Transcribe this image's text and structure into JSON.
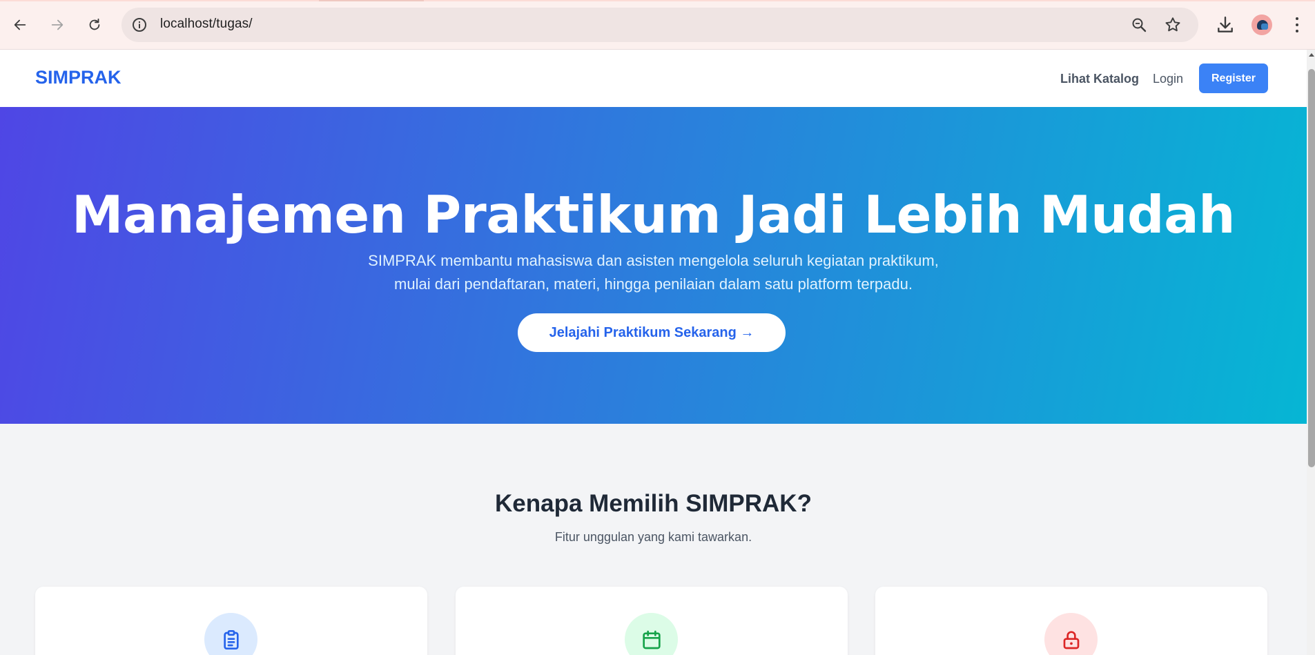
{
  "browser": {
    "url": "localhost/tugas/"
  },
  "nav": {
    "brand": "SIMPRAK",
    "catalog_link": "Lihat Katalog",
    "login_link": "Login",
    "register_button": "Register"
  },
  "hero": {
    "title": "Manajemen Praktikum Jadi Lebih Mudah",
    "subtitle_line1": "SIMPRAK membantu mahasiswa dan asisten mengelola seluruh kegiatan praktikum,",
    "subtitle_line2": "mulai dari pendaftaran, materi, hingga penilaian dalam satu platform terpadu.",
    "cta": "Jelajahi Praktikum Sekarang →"
  },
  "features": {
    "title": "Kenapa Memilih SIMPRAK?",
    "subtitle": "Fitur unggulan yang kami tawarkan.",
    "cards": [
      {
        "icon": "clipboard-icon",
        "color": "#2563eb",
        "bg": "#dbeafe"
      },
      {
        "icon": "calendar-icon",
        "color": "#16a34a",
        "bg": "#dcfce7"
      },
      {
        "icon": "lock-icon",
        "color": "#dc2626",
        "bg": "#fee2e2"
      }
    ]
  },
  "colors": {
    "brand": "#2563eb",
    "register_bg": "#3b82f6",
    "hero_gradient_start": "#4f46e5",
    "hero_gradient_end": "#06b6d4"
  }
}
